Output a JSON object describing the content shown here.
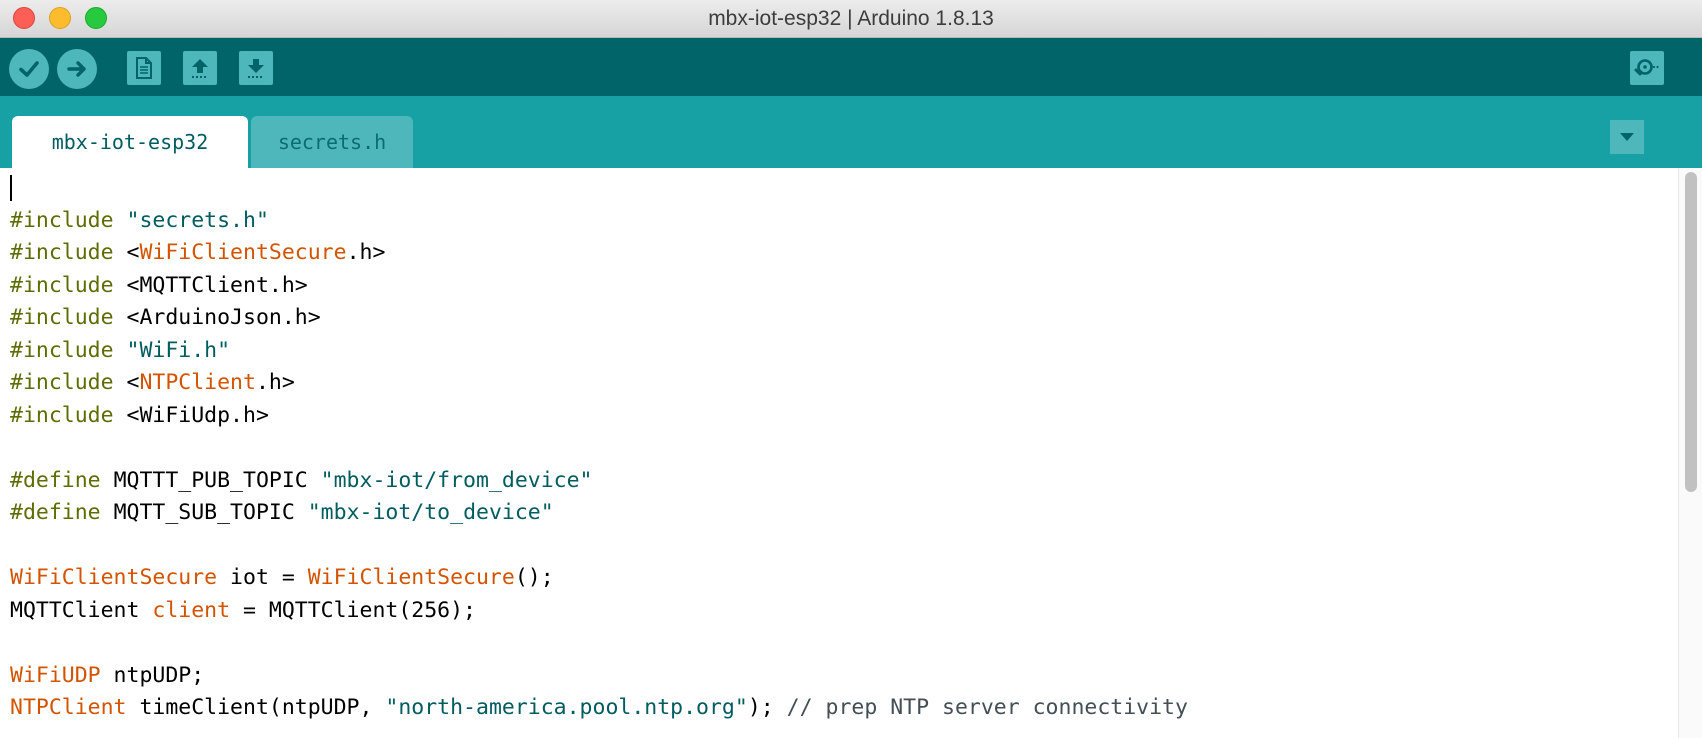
{
  "window": {
    "title": "mbx-iot-esp32 | Arduino 1.8.13"
  },
  "toolbar": {
    "buttons": [
      {
        "name": "verify",
        "icon": "check-icon"
      },
      {
        "name": "upload",
        "icon": "arrow-right-icon"
      },
      {
        "name": "new",
        "icon": "document-icon"
      },
      {
        "name": "open",
        "icon": "arrow-up-icon"
      },
      {
        "name": "save",
        "icon": "arrow-down-icon"
      },
      {
        "name": "serial-monitor",
        "icon": "magnifier-icon"
      }
    ]
  },
  "tabs": [
    {
      "label": "mbx-iot-esp32",
      "active": true
    },
    {
      "label": "secrets.h",
      "active": false
    }
  ],
  "code": {
    "lines": [
      [],
      [
        [
          "pre",
          "#include "
        ],
        [
          "str",
          "\"secrets.h\""
        ]
      ],
      [
        [
          "pre",
          "#include "
        ],
        [
          "txt",
          "<"
        ],
        [
          "cls",
          "WiFiClientSecure"
        ],
        [
          "txt",
          ".h>"
        ]
      ],
      [
        [
          "pre",
          "#include "
        ],
        [
          "txt",
          "<MQTTClient.h>"
        ]
      ],
      [
        [
          "pre",
          "#include "
        ],
        [
          "txt",
          "<ArduinoJson.h>"
        ]
      ],
      [
        [
          "pre",
          "#include "
        ],
        [
          "str",
          "\"WiFi.h\""
        ]
      ],
      [
        [
          "pre",
          "#include "
        ],
        [
          "txt",
          "<"
        ],
        [
          "cls",
          "NTPClient"
        ],
        [
          "txt",
          ".h>"
        ]
      ],
      [
        [
          "pre",
          "#include "
        ],
        [
          "txt",
          "<WiFiUdp.h>"
        ]
      ],
      [],
      [
        [
          "pre",
          "#define "
        ],
        [
          "txt",
          "MQTTT_PUB_TOPIC "
        ],
        [
          "str",
          "\"mbx-iot/from_device\""
        ]
      ],
      [
        [
          "pre",
          "#define "
        ],
        [
          "txt",
          "MQTT_SUB_TOPIC "
        ],
        [
          "str",
          "\"mbx-iot/to_device\""
        ]
      ],
      [],
      [
        [
          "cls",
          "WiFiClientSecure"
        ],
        [
          "txt",
          " iot = "
        ],
        [
          "cls",
          "WiFiClientSecure"
        ],
        [
          "txt",
          "();"
        ]
      ],
      [
        [
          "txt",
          "MQTTClient "
        ],
        [
          "cls",
          "client"
        ],
        [
          "txt",
          " = MQTTClient(256);"
        ]
      ],
      [],
      [
        [
          "cls",
          "WiFiUDP"
        ],
        [
          "txt",
          " ntpUDP;"
        ]
      ],
      [
        [
          "cls",
          "NTPClient"
        ],
        [
          "txt",
          " timeClient(ntpUDP, "
        ],
        [
          "str",
          "\"north-america.pool.ntp.org\""
        ],
        [
          "txt",
          "); "
        ],
        [
          "com",
          "// prep NTP server connectivity"
        ]
      ]
    ]
  },
  "colors": {
    "toolbar_bg": "#006468",
    "tabbar_bg": "#17a1a5",
    "button_bg": "#4db7bb",
    "preprocessor": "#5e6d03",
    "string": "#005c5f",
    "class": "#d35400",
    "comment": "#434f54"
  }
}
